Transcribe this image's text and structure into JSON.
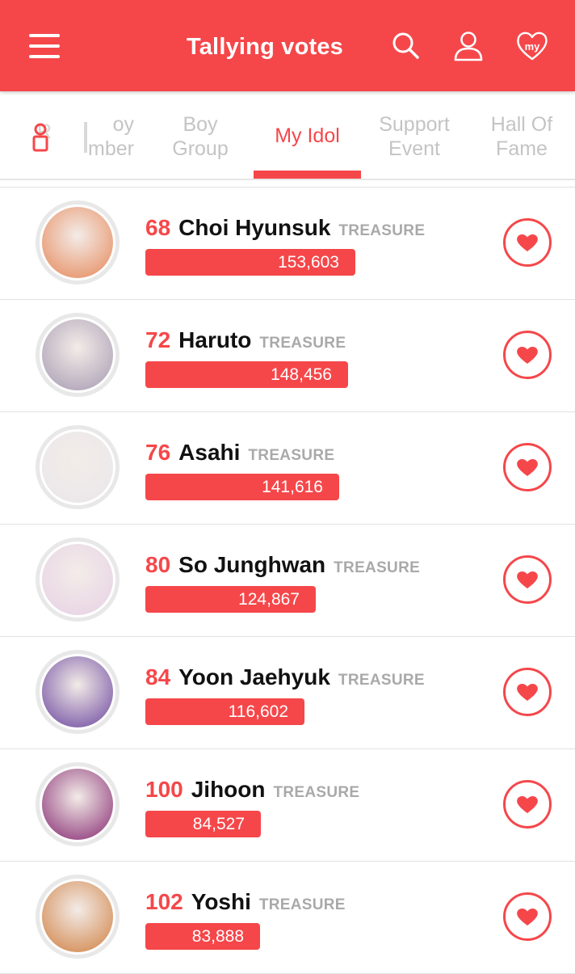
{
  "header": {
    "title": "Tallying votes",
    "my_badge": "my"
  },
  "tabs": [
    {
      "label_line1": "oy",
      "label_line2": "mber",
      "partial_prefix": "R",
      "partial": true
    },
    {
      "label_line1": "Boy",
      "label_line2": "Group"
    },
    {
      "label_line1": "My Idol",
      "label_line2": "",
      "active": true
    },
    {
      "label_line1": "Support",
      "label_line2": "Event"
    },
    {
      "label_line1": "Hall Of",
      "label_line2": "Fame"
    }
  ],
  "colors": {
    "accent": "#f5474a",
    "inactive_tab": "#c4c4c4",
    "group_label": "#a9a9a9"
  },
  "idols": [
    {
      "rank": "68",
      "name": "Choi Hyunsuk",
      "group": "TREASURE",
      "votes": "153,603",
      "vote_fraction": 1.0,
      "avatar_color": "#e9a07c"
    },
    {
      "rank": "72",
      "name": "Haruto",
      "group": "TREASURE",
      "votes": "148,456",
      "vote_fraction": 0.966,
      "avatar_color": "#b8aebf"
    },
    {
      "rank": "76",
      "name": "Asahi",
      "group": "TREASURE",
      "votes": "141,616",
      "vote_fraction": 0.922,
      "avatar_color": "#ece8ea"
    },
    {
      "rank": "80",
      "name": "So Junghwan",
      "group": "TREASURE",
      "votes": "124,867",
      "vote_fraction": 0.813,
      "avatar_color": "#ead8e6"
    },
    {
      "rank": "84",
      "name": "Yoon Jaehyuk",
      "group": "TREASURE",
      "votes": "116,602",
      "vote_fraction": 0.759,
      "avatar_color": "#8c6eb0"
    },
    {
      "rank": "100",
      "name": "Jihoon",
      "group": "TREASURE",
      "votes": "84,527",
      "vote_fraction": 0.55,
      "avatar_color": "#a0588e"
    },
    {
      "rank": "102",
      "name": "Yoshi",
      "group": "TREASURE",
      "votes": "83,888",
      "vote_fraction": 0.546,
      "avatar_color": "#d89a6a"
    }
  ]
}
